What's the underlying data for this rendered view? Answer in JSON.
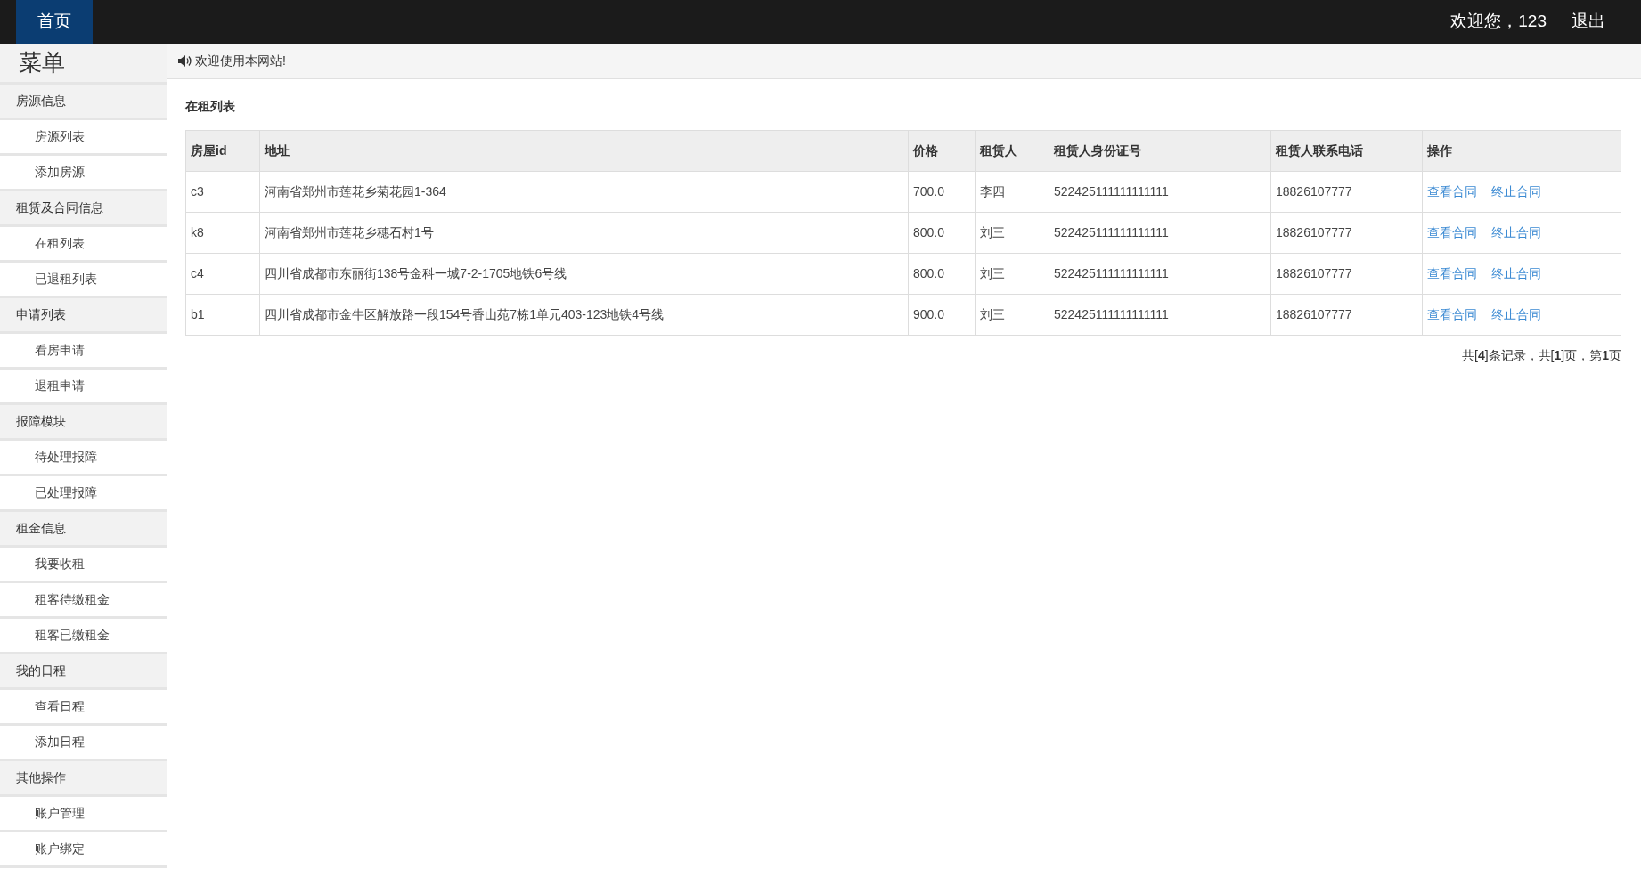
{
  "header": {
    "home_tab": {
      "label": "首页",
      "selected": true
    },
    "greeting": "欢迎您，123",
    "logout": "退出"
  },
  "sidebar": {
    "title": "菜单",
    "groups": [
      {
        "label": "房源信息",
        "children": [
          {
            "label": "房源列表"
          },
          {
            "label": "添加房源"
          }
        ]
      },
      {
        "label": "租赁及合同信息",
        "children": [
          {
            "label": "在租列表"
          },
          {
            "label": "已退租列表"
          }
        ]
      },
      {
        "label": "申请列表",
        "children": [
          {
            "label": "看房申请"
          },
          {
            "label": "退租申请"
          }
        ]
      },
      {
        "label": "报障模块",
        "children": [
          {
            "label": "待处理报障"
          },
          {
            "label": "已处理报障"
          }
        ]
      },
      {
        "label": "租金信息",
        "children": [
          {
            "label": "我要收租"
          },
          {
            "label": "租客待缴租金"
          },
          {
            "label": "租客已缴租金"
          }
        ]
      },
      {
        "label": "我的日程",
        "children": [
          {
            "label": "查看日程"
          },
          {
            "label": "添加日程"
          }
        ]
      },
      {
        "label": "其他操作",
        "children": [
          {
            "label": "账户管理"
          },
          {
            "label": "账户绑定"
          }
        ]
      }
    ]
  },
  "notice": "欢迎使用本网站!",
  "table": {
    "title": "在租列表",
    "columns": [
      "房屋id",
      "地址",
      "价格",
      "租赁人",
      "租赁人身份证号",
      "租赁人联系电话",
      "操作"
    ],
    "rows": [
      {
        "cells": [
          "c3",
          "河南省郑州市莲花乡菊花园1-364",
          "700.0",
          "李四",
          "522425111111111111",
          "18826107777"
        ],
        "actions": [
          "查看合同",
          "终止合同"
        ]
      },
      {
        "cells": [
          "k8",
          "河南省郑州市莲花乡穗石村1号",
          "800.0",
          "刘三",
          "522425111111111111",
          "18826107777"
        ],
        "actions": [
          "查看合同",
          "终止合同"
        ]
      },
      {
        "cells": [
          "c4",
          "四川省成都市东丽街138号金科一城7-2-1705地铁6号线",
          "800.0",
          "刘三",
          "522425111111111111",
          "18826107777"
        ],
        "actions": [
          "查看合同",
          "终止合同"
        ]
      },
      {
        "cells": [
          "b1",
          "四川省成都市金牛区解放路一段154号香山苑7栋1单元403-123地铁4号线",
          "900.0",
          "刘三",
          "522425111111111111",
          "18826107777"
        ],
        "actions": [
          "查看合同",
          "终止合同"
        ]
      }
    ],
    "pagination": "共[**4**]条记录，共[**1**]页，第**1**页"
  }
}
